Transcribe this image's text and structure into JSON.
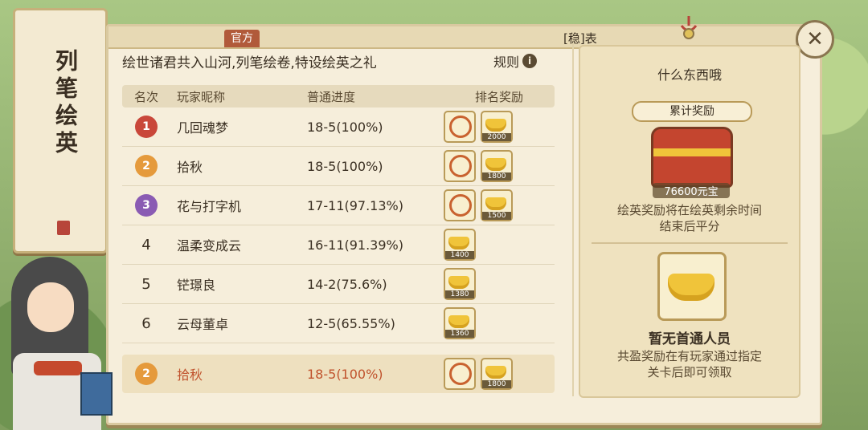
{
  "side_banner": {
    "title": "列笔绘英"
  },
  "tabs": {
    "official": "官方",
    "stable": "[稳]表"
  },
  "close_label": "✕",
  "intro": "绘世诸君共入山河,列笔绘卷,特设绘英之礼",
  "rules_label": "规则",
  "info_glyph": "i",
  "table": {
    "headers": {
      "rank": "名次",
      "name": "玩家昵称",
      "progress": "普通进度",
      "rewards": "排名奖励"
    },
    "rows": [
      {
        "rank": "1",
        "name": "几回魂梦",
        "progress": "18-5(100%)",
        "rewards": [
          "ring",
          "2000"
        ],
        "medal_color": "#c9473a"
      },
      {
        "rank": "2",
        "name": "拾秋",
        "progress": "18-5(100%)",
        "rewards": [
          "ring",
          "1800"
        ],
        "medal_color": "#e59a3c"
      },
      {
        "rank": "3",
        "name": "花与打字机",
        "progress": "17-11(97.13%)",
        "rewards": [
          "ring",
          "1500"
        ],
        "medal_color": "#8a5bb3"
      },
      {
        "rank": "4",
        "name": "温柔变成云",
        "progress": "16-11(91.39%)",
        "rewards": [
          "1400"
        ]
      },
      {
        "rank": "5",
        "name": "铓璟良",
        "progress": "14-2(75.6%)",
        "rewards": [
          "1380"
        ]
      },
      {
        "rank": "6",
        "name": "云母董卓",
        "progress": "12-5(65.55%)",
        "rewards": [
          "1360"
        ]
      }
    ]
  },
  "my_row": {
    "rank": "2",
    "name": "拾秋",
    "progress": "18-5(100%)",
    "reward_qty": "1800"
  },
  "right_panel": {
    "title": "什么东西哦",
    "accumulated_label": "累计奖励",
    "chest_value": "76600元宝",
    "note1_line1": "绘英奖励将在绘英剩余时间",
    "note1_line2": "结束后平分",
    "none_label": "暂无首通人员",
    "note2_line1": "共盈奖励在有玩家通过指定",
    "note2_line2": "关卡后即可领取"
  }
}
